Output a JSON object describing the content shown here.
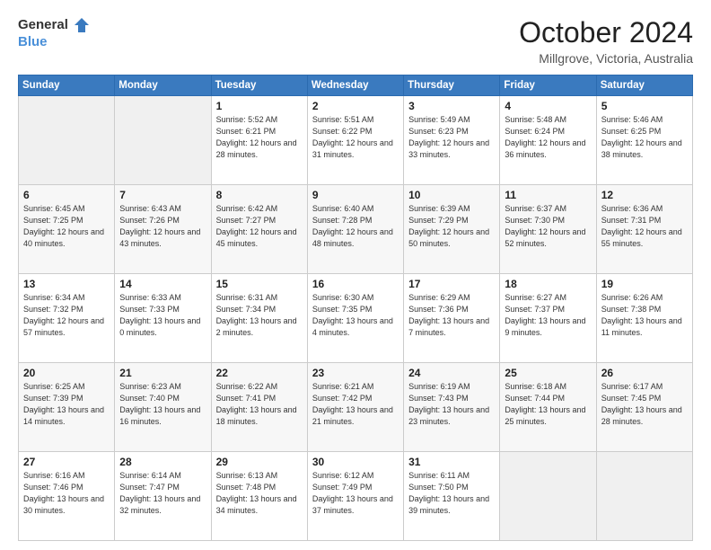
{
  "header": {
    "logo_general": "General",
    "logo_blue": "Blue",
    "month": "October 2024",
    "location": "Millgrove, Victoria, Australia"
  },
  "days_of_week": [
    "Sunday",
    "Monday",
    "Tuesday",
    "Wednesday",
    "Thursday",
    "Friday",
    "Saturday"
  ],
  "weeks": [
    [
      {
        "day": "",
        "detail": ""
      },
      {
        "day": "",
        "detail": ""
      },
      {
        "day": "1",
        "detail": "Sunrise: 5:52 AM\nSunset: 6:21 PM\nDaylight: 12 hours and 28 minutes."
      },
      {
        "day": "2",
        "detail": "Sunrise: 5:51 AM\nSunset: 6:22 PM\nDaylight: 12 hours and 31 minutes."
      },
      {
        "day": "3",
        "detail": "Sunrise: 5:49 AM\nSunset: 6:23 PM\nDaylight: 12 hours and 33 minutes."
      },
      {
        "day": "4",
        "detail": "Sunrise: 5:48 AM\nSunset: 6:24 PM\nDaylight: 12 hours and 36 minutes."
      },
      {
        "day": "5",
        "detail": "Sunrise: 5:46 AM\nSunset: 6:25 PM\nDaylight: 12 hours and 38 minutes."
      }
    ],
    [
      {
        "day": "6",
        "detail": "Sunrise: 6:45 AM\nSunset: 7:25 PM\nDaylight: 12 hours and 40 minutes."
      },
      {
        "day": "7",
        "detail": "Sunrise: 6:43 AM\nSunset: 7:26 PM\nDaylight: 12 hours and 43 minutes."
      },
      {
        "day": "8",
        "detail": "Sunrise: 6:42 AM\nSunset: 7:27 PM\nDaylight: 12 hours and 45 minutes."
      },
      {
        "day": "9",
        "detail": "Sunrise: 6:40 AM\nSunset: 7:28 PM\nDaylight: 12 hours and 48 minutes."
      },
      {
        "day": "10",
        "detail": "Sunrise: 6:39 AM\nSunset: 7:29 PM\nDaylight: 12 hours and 50 minutes."
      },
      {
        "day": "11",
        "detail": "Sunrise: 6:37 AM\nSunset: 7:30 PM\nDaylight: 12 hours and 52 minutes."
      },
      {
        "day": "12",
        "detail": "Sunrise: 6:36 AM\nSunset: 7:31 PM\nDaylight: 12 hours and 55 minutes."
      }
    ],
    [
      {
        "day": "13",
        "detail": "Sunrise: 6:34 AM\nSunset: 7:32 PM\nDaylight: 12 hours and 57 minutes."
      },
      {
        "day": "14",
        "detail": "Sunrise: 6:33 AM\nSunset: 7:33 PM\nDaylight: 13 hours and 0 minutes."
      },
      {
        "day": "15",
        "detail": "Sunrise: 6:31 AM\nSunset: 7:34 PM\nDaylight: 13 hours and 2 minutes."
      },
      {
        "day": "16",
        "detail": "Sunrise: 6:30 AM\nSunset: 7:35 PM\nDaylight: 13 hours and 4 minutes."
      },
      {
        "day": "17",
        "detail": "Sunrise: 6:29 AM\nSunset: 7:36 PM\nDaylight: 13 hours and 7 minutes."
      },
      {
        "day": "18",
        "detail": "Sunrise: 6:27 AM\nSunset: 7:37 PM\nDaylight: 13 hours and 9 minutes."
      },
      {
        "day": "19",
        "detail": "Sunrise: 6:26 AM\nSunset: 7:38 PM\nDaylight: 13 hours and 11 minutes."
      }
    ],
    [
      {
        "day": "20",
        "detail": "Sunrise: 6:25 AM\nSunset: 7:39 PM\nDaylight: 13 hours and 14 minutes."
      },
      {
        "day": "21",
        "detail": "Sunrise: 6:23 AM\nSunset: 7:40 PM\nDaylight: 13 hours and 16 minutes."
      },
      {
        "day": "22",
        "detail": "Sunrise: 6:22 AM\nSunset: 7:41 PM\nDaylight: 13 hours and 18 minutes."
      },
      {
        "day": "23",
        "detail": "Sunrise: 6:21 AM\nSunset: 7:42 PM\nDaylight: 13 hours and 21 minutes."
      },
      {
        "day": "24",
        "detail": "Sunrise: 6:19 AM\nSunset: 7:43 PM\nDaylight: 13 hours and 23 minutes."
      },
      {
        "day": "25",
        "detail": "Sunrise: 6:18 AM\nSunset: 7:44 PM\nDaylight: 13 hours and 25 minutes."
      },
      {
        "day": "26",
        "detail": "Sunrise: 6:17 AM\nSunset: 7:45 PM\nDaylight: 13 hours and 28 minutes."
      }
    ],
    [
      {
        "day": "27",
        "detail": "Sunrise: 6:16 AM\nSunset: 7:46 PM\nDaylight: 13 hours and 30 minutes."
      },
      {
        "day": "28",
        "detail": "Sunrise: 6:14 AM\nSunset: 7:47 PM\nDaylight: 13 hours and 32 minutes."
      },
      {
        "day": "29",
        "detail": "Sunrise: 6:13 AM\nSunset: 7:48 PM\nDaylight: 13 hours and 34 minutes."
      },
      {
        "day": "30",
        "detail": "Sunrise: 6:12 AM\nSunset: 7:49 PM\nDaylight: 13 hours and 37 minutes."
      },
      {
        "day": "31",
        "detail": "Sunrise: 6:11 AM\nSunset: 7:50 PM\nDaylight: 13 hours and 39 minutes."
      },
      {
        "day": "",
        "detail": ""
      },
      {
        "day": "",
        "detail": ""
      }
    ]
  ]
}
